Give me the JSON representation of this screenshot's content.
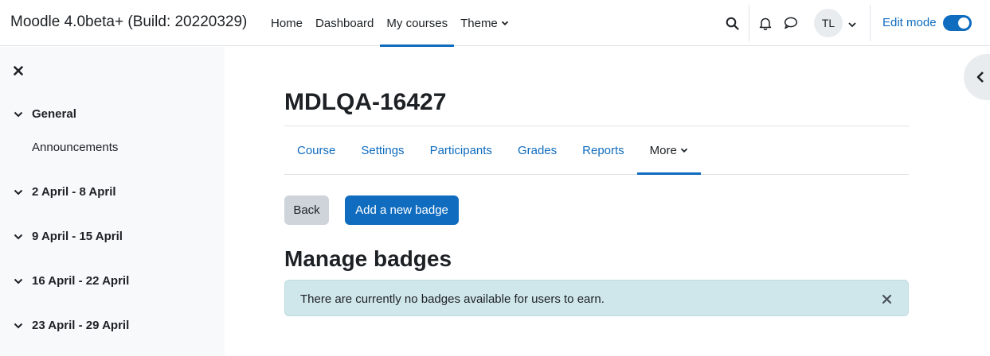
{
  "navbar": {
    "brand": "Moodle 4.0beta+ (Build: 20220329)",
    "items": [
      {
        "label": "Home"
      },
      {
        "label": "Dashboard"
      },
      {
        "label": "My courses"
      },
      {
        "label": "Theme"
      }
    ],
    "active_item": "My courses",
    "user_initials": "TL",
    "edit_mode_label": "Edit mode",
    "edit_mode_on": true
  },
  "drawer": {
    "sections": [
      {
        "label": "General",
        "items": [
          "Announcements"
        ]
      },
      {
        "label": "2 April - 8 April"
      },
      {
        "label": "9 April - 15 April"
      },
      {
        "label": "16 April - 22 April"
      },
      {
        "label": "23 April - 29 April"
      }
    ]
  },
  "main": {
    "title": "MDLQA-16427",
    "secondary_nav": [
      {
        "label": "Course"
      },
      {
        "label": "Settings"
      },
      {
        "label": "Participants"
      },
      {
        "label": "Grades"
      },
      {
        "label": "Reports"
      },
      {
        "label": "More"
      }
    ],
    "active_secondary": "More",
    "back_label": "Back",
    "add_badge_label": "Add a new badge",
    "heading": "Manage badges",
    "alert_text": "There are currently no badges available for users to earn."
  },
  "colors": {
    "accent": "#0f6cbf",
    "drawer_bg": "#f8f9fa",
    "alert_bg": "#cfe6ea"
  },
  "icons": {
    "search": "search-icon",
    "notifications": "bell-icon",
    "messages": "chat-bubble-icon",
    "drawer_close": "close-icon",
    "section_toggle": "chevron-down-icon",
    "right_drawer": "chevron-left-icon",
    "alert_dismiss": "close-icon"
  }
}
